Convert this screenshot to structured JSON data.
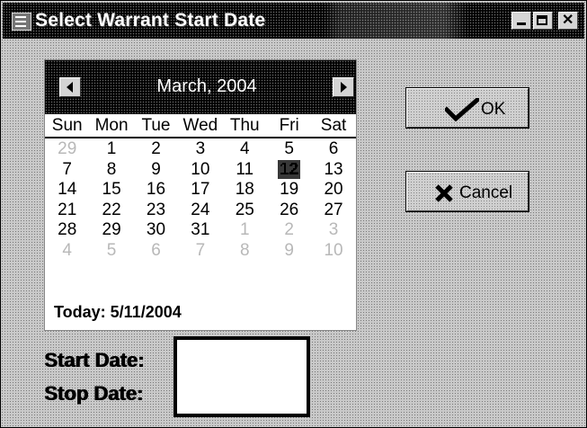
{
  "window": {
    "title": "Select Warrant Start Date",
    "buttons": [
      "minimize",
      "maximize",
      "close"
    ]
  },
  "calendar": {
    "month_label": "March, 2004",
    "day_headers": [
      "Sun",
      "Mon",
      "Tue",
      "Wed",
      "Thu",
      "Fri",
      "Sat"
    ],
    "weeks": [
      [
        {
          "d": "29",
          "o": true
        },
        {
          "d": "1"
        },
        {
          "d": "2"
        },
        {
          "d": "3"
        },
        {
          "d": "4"
        },
        {
          "d": "5"
        },
        {
          "d": "6"
        }
      ],
      [
        {
          "d": "7"
        },
        {
          "d": "8"
        },
        {
          "d": "9"
        },
        {
          "d": "10"
        },
        {
          "d": "11"
        },
        {
          "d": "12",
          "t": true
        },
        {
          "d": "13"
        }
      ],
      [
        {
          "d": "14"
        },
        {
          "d": "15"
        },
        {
          "d": "16"
        },
        {
          "d": "17"
        },
        {
          "d": "18"
        },
        {
          "d": "19"
        },
        {
          "d": "20"
        }
      ],
      [
        {
          "d": "21"
        },
        {
          "d": "22"
        },
        {
          "d": "23"
        },
        {
          "d": "24"
        },
        {
          "d": "25"
        },
        {
          "d": "26"
        },
        {
          "d": "27"
        }
      ],
      [
        {
          "d": "28"
        },
        {
          "d": "29"
        },
        {
          "d": "30"
        },
        {
          "d": "31"
        },
        {
          "d": "1",
          "o": true
        },
        {
          "d": "2",
          "o": true
        },
        {
          "d": "3",
          "o": true
        }
      ],
      [
        {
          "d": "4",
          "o": true
        },
        {
          "d": "5",
          "o": true
        },
        {
          "d": "6",
          "o": true
        },
        {
          "d": "7",
          "o": true
        },
        {
          "d": "8",
          "o": true
        },
        {
          "d": "9",
          "o": true
        },
        {
          "d": "10",
          "o": true
        }
      ]
    ],
    "today_text": "Today: 5/11/2004"
  },
  "buttons": {
    "ok_label": "OK",
    "cancel_label": "Cancel"
  },
  "fields": {
    "start_label": "Start Date:",
    "stop_label": "Stop Date:"
  },
  "icons": {
    "titlebar": "app-icon",
    "prev": "arrow-left-icon",
    "next": "arrow-right-icon",
    "ok": "checkmark-icon",
    "cancel": "x-icon"
  }
}
